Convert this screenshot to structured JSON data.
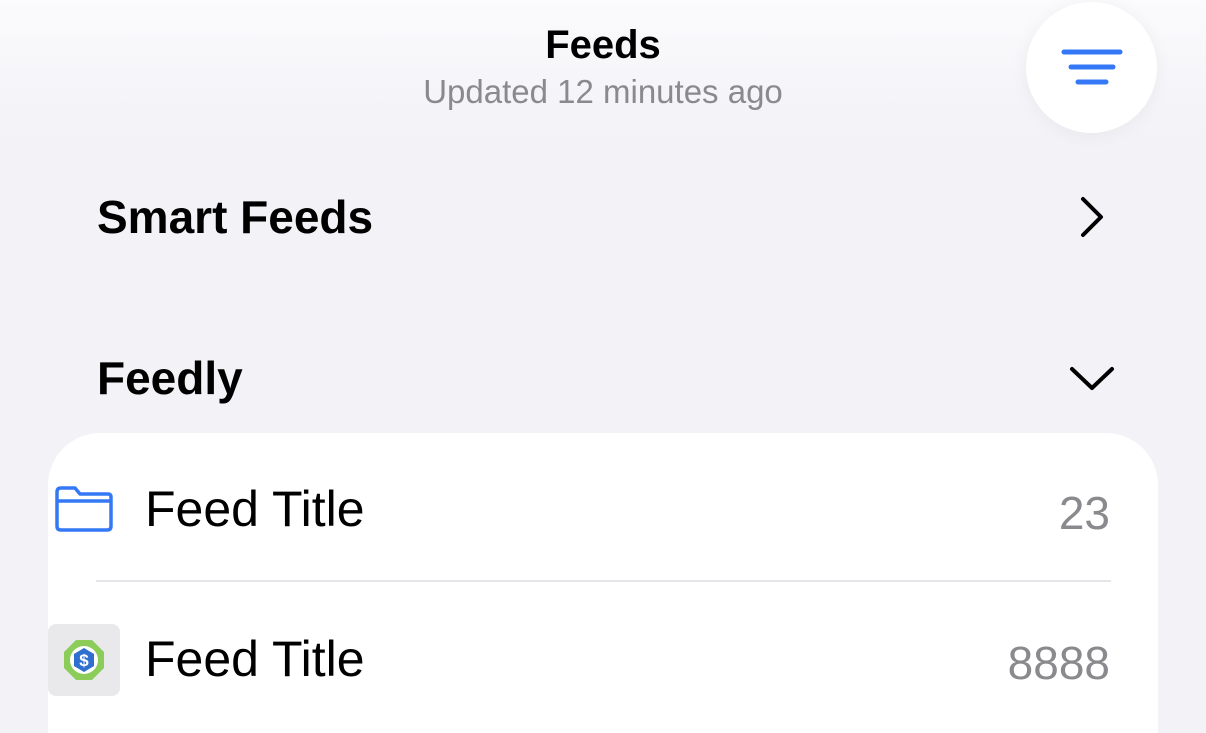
{
  "header": {
    "title": "Feeds",
    "subtitle": "Updated 12 minutes ago",
    "menu_icon": "menu-lines-icon"
  },
  "sections": [
    {
      "label": "Smart Feeds",
      "icon": "chevron-right-icon"
    },
    {
      "label": "Feedly",
      "icon": "chevron-down-icon"
    }
  ],
  "feeds": [
    {
      "title": "Feed Title",
      "count": "23",
      "icon": "folder-icon"
    },
    {
      "title": "Feed Title",
      "count": "8888",
      "icon": "favicon-icon"
    }
  ],
  "colors": {
    "accent": "#3478f6",
    "background": "#f2f2f7",
    "secondary_text": "#8a8a8e"
  }
}
